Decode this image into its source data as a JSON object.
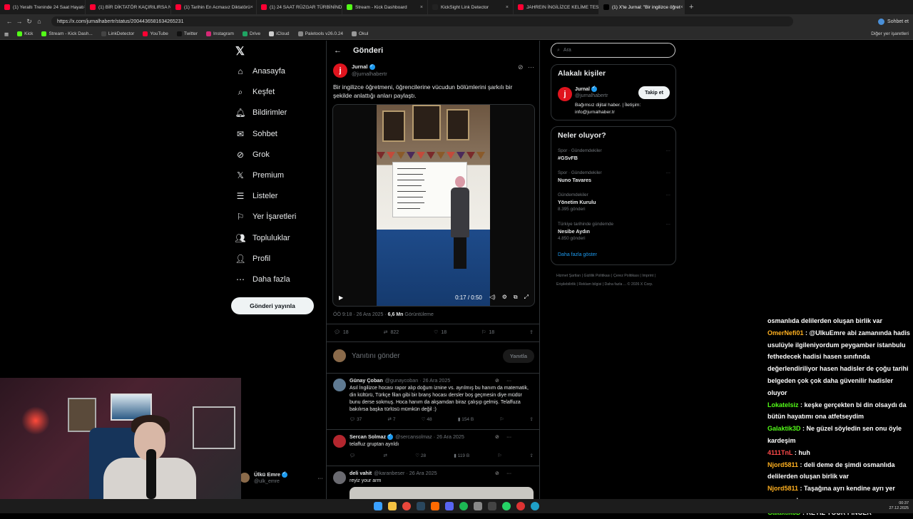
{
  "browser": {
    "tabs": [
      {
        "label": "(1) Yeraltı Treninde 24 Saat Hayatı",
        "color": "#ff0033"
      },
      {
        "label": "(1) BİR DİKTATÖR KAÇIRILIRSA NE",
        "color": "#ff0033"
      },
      {
        "label": "(1) Tarihin En Acmasız Diktatörü",
        "color": "#ff0033"
      },
      {
        "label": "(1) 24 SAAT RÜZGAR TÜRBİNİNDE",
        "color": "#ff0033"
      },
      {
        "label": "Stream - Kick Dashboard",
        "color": "#53fc18"
      },
      {
        "label": "KickSight Link Detector",
        "color": "#222222"
      },
      {
        "label": "JAHREIN İNGİLİZCE KELİME TESTİ",
        "color": "#ff0033"
      },
      {
        "label": "(1) X'te Jurnal: \"Bir ingilizce öğret",
        "color": "#000000"
      }
    ],
    "url": "https://x.com/jurnalhabertr/status/2004436581634265231",
    "profile_label": "Sohbet et",
    "bookmarks": [
      {
        "label": "Kick",
        "color": "#53fc18"
      },
      {
        "label": "Stream - Kick Dash...",
        "color": "#53fc18"
      },
      {
        "label": "LinkDetector",
        "color": "#444444"
      },
      {
        "label": "YouTube",
        "color": "#ff0033"
      },
      {
        "label": "Twitter",
        "color": "#111111"
      },
      {
        "label": "Instagram",
        "color": "#d62976"
      },
      {
        "label": "Drive",
        "color": "#1fa463"
      },
      {
        "label": "iCloud",
        "color": "#cccccc"
      },
      {
        "label": "Paletools v26.0.24",
        "color": "#888888"
      },
      {
        "label": "Okul",
        "color": "#999999"
      }
    ],
    "bookmarks_other": "Diğer yer işaretleri"
  },
  "nav": {
    "items": [
      {
        "label": "Anasayfa",
        "icon": "home-icon"
      },
      {
        "label": "Keşfet",
        "icon": "search-icon"
      },
      {
        "label": "Bildirimler",
        "icon": "bell-icon"
      },
      {
        "label": "Sohbet",
        "icon": "mail-icon"
      },
      {
        "label": "Grok",
        "icon": "grok-icon"
      },
      {
        "label": "Premium",
        "icon": "x-icon"
      },
      {
        "label": "Listeler",
        "icon": "list-icon"
      },
      {
        "label": "Yer İşaretleri",
        "icon": "bookmark-icon"
      },
      {
        "label": "Topluluklar",
        "icon": "people-icon"
      },
      {
        "label": "Profil",
        "icon": "person-icon"
      },
      {
        "label": "Daha fazla",
        "icon": "more-icon"
      }
    ],
    "post_button": "Gönderi yayınla",
    "account": {
      "name": "Ülkü Emre",
      "handle": "@ulk_emre"
    }
  },
  "main": {
    "header": "Gönderi",
    "post": {
      "author": "Jurnal",
      "handle": "@jurnalhabertr",
      "avatar_letter": "j",
      "text": "Bir ingilizce öğretmeni, öğrencilerine vücudun bölümlerini şarkılı bir şekilde anlattığı anları paylaştı.",
      "video_time": "0:17 / 0:50",
      "meta_time": "ÖÖ 9:18 · 26 Ara 2025 · ",
      "views": "6,6 Mn",
      "views_label": " Görüntüleme",
      "replies": "18",
      "reposts": "822",
      "likes": "18",
      "bookmarks": "18"
    },
    "reply_placeholder": "Yanıtını gönder",
    "reply_button": "Yanıtla",
    "replies": [
      {
        "name": "Günay Çoban",
        "handle": "@gunaycoban · 26 Ara 2025",
        "text": "Asıl İngilizce hocası rapor alıp doğum iznine vs. ayrılmış bu hanım da matematik, din kültürü, Türkçe filan gibi bir branş hocası dersler boş geçmesin diye müdür bunu derse sokmuş. Hoca hanım da akşamdan biraz çalışıp gelmiş. Telaffuza bakılırsa başka türlüsü mümkün değil :)",
        "replies": "37",
        "reposts": "7",
        "likes": "48",
        "views": "154 B",
        "verified": false,
        "avatar_color": "#5f7a92"
      },
      {
        "name": "Sercan Solmaz",
        "handle": "@sercansolmaz · 26 Ara 2025",
        "text": "telaffuz gruptan ayrıldı",
        "replies": "",
        "reposts": "",
        "likes": "28",
        "views": "119 B",
        "verified": true,
        "avatar_color": "#b3262e"
      },
      {
        "name": "deli vahit",
        "handle": "@karanbeser · 26 Ara 2025",
        "text": "reyiz your arm",
        "replies": "",
        "reposts": "",
        "likes": "",
        "views": "",
        "verified": false,
        "avatar_color": "#6a6a70"
      }
    ]
  },
  "right": {
    "search_placeholder": "Ara",
    "related": {
      "title": "Alakalı kişiler",
      "name": "Jurnal",
      "handle": "@jurnalhabertr",
      "bio": "Bağımsız dijital haber. | İletişim: info@jurnalhaber.tr",
      "follow": "Takip et"
    },
    "trends": {
      "title": "Neler oluyor?",
      "items": [
        {
          "context": "Spor · Gündemdekiler",
          "name": "#GSvFB",
          "count": ""
        },
        {
          "context": "Spor · Gündemdekiler",
          "name": "Nuno Tavares",
          "count": ""
        },
        {
          "context": "Gündemdekiler",
          "name": "Yönetim Kurulu",
          "count": "8.395 gönderi"
        },
        {
          "context": "Türkiye tarihinde gündemde",
          "name": "Nesibe Aydın",
          "count": "4.850 gönderi"
        }
      ],
      "show_more": "Daha fazla göster"
    },
    "footer": "Hizmet Şartları | Gizlilik Politikası | Çerez Politikası | Imprint | Erişilebilirlik | Reklam bilgisi | Daha fazla ... © 2026 X Corp."
  },
  "chat": [
    {
      "user": "",
      "text": "osmanlıda delilerden oluşan birlik var",
      "color": "#ffffff"
    },
    {
      "user": "OmerNefi01",
      "text": " : @UlkuEmre abi zamanında hadis usulüyle ilgileniyordum peygamber istanbulu fethedecek hadisi hasen sınıfında değerlendiriliyor hasen hadisler de çoğu tarihi belgeden çok çok daha güvenilir hadisler oluyor",
      "color": "#ffb020"
    },
    {
      "user": "Lokatelsiz",
      "text": " : keşke gerçekten bi din olsaydı da bütün hayatımı ona atfetseydim",
      "color": "#53fc18"
    },
    {
      "user": "Galaktik3D",
      "text": " : Ne güzel söyledin sen onu öyle kardeşim",
      "color": "#53fc18"
    },
    {
      "user": "4111TnL",
      "text": " : huh",
      "color": "#ff4a4a"
    },
    {
      "user": "Njord5811",
      "text": " : deli deme de şimdi osmanlıda delilerden oluşan birlik var",
      "color": "#ffb020"
    },
    {
      "user": "Njord5811",
      "text": " : Taşağına ayrı kendine ayrı yer açmamız lazım",
      "color": "#ffb020"
    },
    {
      "user": "Galaktik3D",
      "text": " : REYİZ YOUR FINGER",
      "color": "#53fc18"
    }
  ],
  "taskbar": {
    "clock": "00:37",
    "date": "27.12.2025"
  }
}
